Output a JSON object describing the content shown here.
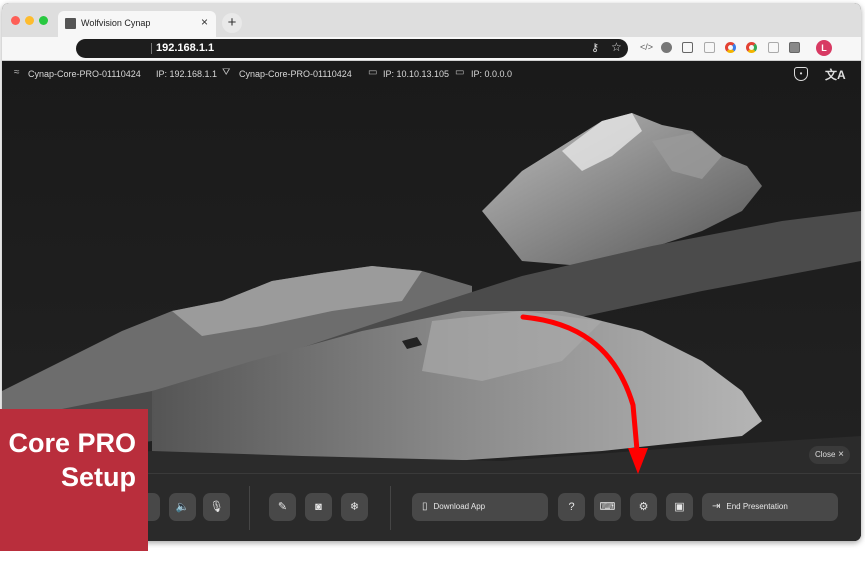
{
  "browser": {
    "tab_title": "Wolfvision Cynap",
    "tab_close": "×",
    "new_tab": "+",
    "url": "192.168.1.1",
    "profile_initial": "L",
    "profile_color": "#d83a63"
  },
  "infobar": {
    "wifi_name": "Cynap-Core-PRO-01110424",
    "wifi_ip": "IP: 192.168.1.1",
    "lan_name": "Cynap-Core-PRO-01110424",
    "lan_ip_1": "IP: 10.10.13.105",
    "lan_ip_2": "IP: 0.0.0.0",
    "icons": [
      "wifi-icon",
      "network-icon",
      "ethernet-icon",
      "ethernet-icon",
      "shield-user-icon",
      "language-icon"
    ]
  },
  "close_pill": {
    "label": "Close",
    "x": "×"
  },
  "dock": {
    "download_app": "Download App",
    "end_presentation": "End Presentation",
    "icons": [
      "volume-icon",
      "microphone-icon",
      "annotate-icon",
      "camera-icon",
      "freeze-icon",
      "phone-icon",
      "help-icon",
      "keyboard-icon",
      "settings-icon",
      "screen-icon",
      "exit-icon"
    ]
  },
  "badge": {
    "line1": "Core PRO",
    "line2": "Setup",
    "color": "#b92e3c"
  },
  "accent": {
    "arrow": "#ff0000"
  }
}
